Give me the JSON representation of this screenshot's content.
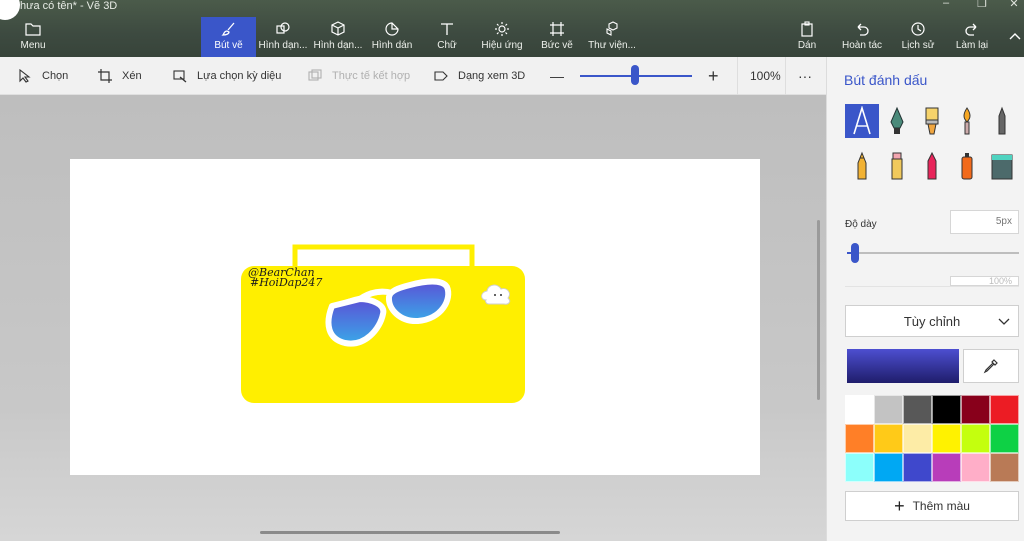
{
  "window": {
    "title": "hưa có tên* - Vẽ 3D",
    "controls": [
      "–",
      "❐",
      "✕"
    ]
  },
  "ribbon": {
    "menu_label": "Menu",
    "tools": [
      {
        "label": "Bút vẽ",
        "icon": "brush-icon",
        "active": true
      },
      {
        "label": "Hình dạn...",
        "icon": "shapes-2d-icon"
      },
      {
        "label": "Hình dạn...",
        "icon": "shapes-3d-icon"
      },
      {
        "label": "Hình dán",
        "icon": "sticker-icon"
      },
      {
        "label": "Chữ",
        "icon": "text-icon"
      },
      {
        "label": "Hiệu ứng",
        "icon": "effects-icon"
      },
      {
        "label": "Bức vẽ",
        "icon": "canvas-icon"
      },
      {
        "label": "Thư viện...",
        "icon": "library-icon"
      }
    ],
    "right": [
      {
        "label": "Dán",
        "icon": "paste-icon"
      },
      {
        "label": "Hoàn tác",
        "icon": "undo-icon"
      },
      {
        "label": "Lịch sử",
        "icon": "history-icon"
      },
      {
        "label": "Làm lại",
        "icon": "redo-icon"
      }
    ]
  },
  "toolbar": {
    "select": "Chọn",
    "crop": "Xén",
    "magic_select": "Lựa chọn kỳ diệu",
    "mixed_reality": "Thực tế kết hợp",
    "view_3d": "Dạng xem 3D",
    "zoom_minus": "—",
    "zoom_plus": "+",
    "zoom_level": "100%",
    "more": "···",
    "zoom_value": 0.5
  },
  "canvas": {
    "tag1": "@BearChan",
    "tag2": "#HoiDap247",
    "colors": {
      "boombox": "#ffef00",
      "lens_top": "#5b52d6",
      "lens_bottom": "#3aa7e8"
    }
  },
  "panel": {
    "title": "Bút đánh dấu",
    "brushes": [
      "marker-icon",
      "calligraphy-pen-icon",
      "oil-brush-icon",
      "watercolor-icon",
      "pencil-icon",
      "crayon-icon",
      "eraser-icon",
      "highlighter-icon",
      "spray-can-icon",
      "fill-bucket-icon"
    ],
    "thickness_label": "Độ dày",
    "thickness_value": "5px",
    "opacity_value": "100%",
    "finish_dropdown": "Tùy chỉnh",
    "current_color": "#3f3fc0",
    "palette": [
      "#ffffff",
      "#c3c3c3",
      "#585858",
      "#000000",
      "#88001b",
      "#ec1c24",
      "#ff7f27",
      "#ffca18",
      "#fdeca6",
      "#fff200",
      "#c4ff0e",
      "#0ed145",
      "#8cfffb",
      "#00a8f3",
      "#3f48cc",
      "#b83dba",
      "#ffaec8",
      "#b97a56"
    ],
    "add_color": "Thêm màu"
  }
}
